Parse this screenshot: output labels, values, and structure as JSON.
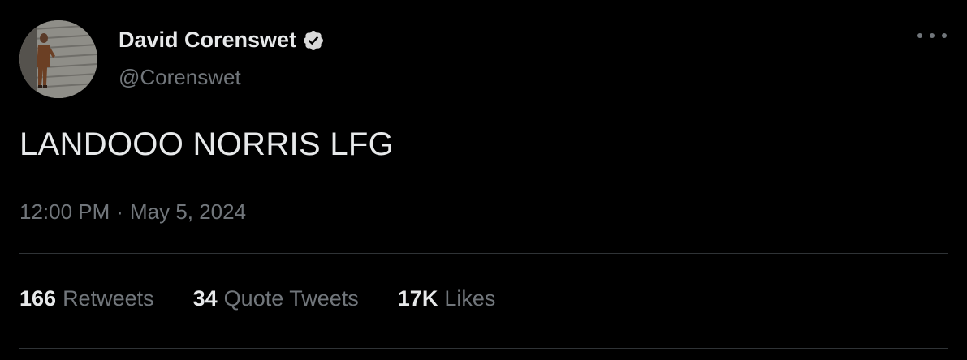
{
  "tweet": {
    "author": {
      "display_name": "David Corenswet",
      "handle": "@Corenswet",
      "verified": true,
      "verified_icon": "verified-badge-icon",
      "avatar_icon": "profile-photo"
    },
    "more_icon": "more-options-icon",
    "text": "LANDOOO NORRIS LFG",
    "time": "12:00 PM",
    "separator": "·",
    "date": "May 5, 2024",
    "stats": [
      {
        "value": "166",
        "label": "Retweets"
      },
      {
        "value": "34",
        "label": "Quote Tweets"
      },
      {
        "value": "17K",
        "label": "Likes"
      }
    ]
  },
  "colors": {
    "background": "#000000",
    "primary_text": "#e7e9ea",
    "secondary_text": "#71767b",
    "divider": "#2f3336"
  }
}
